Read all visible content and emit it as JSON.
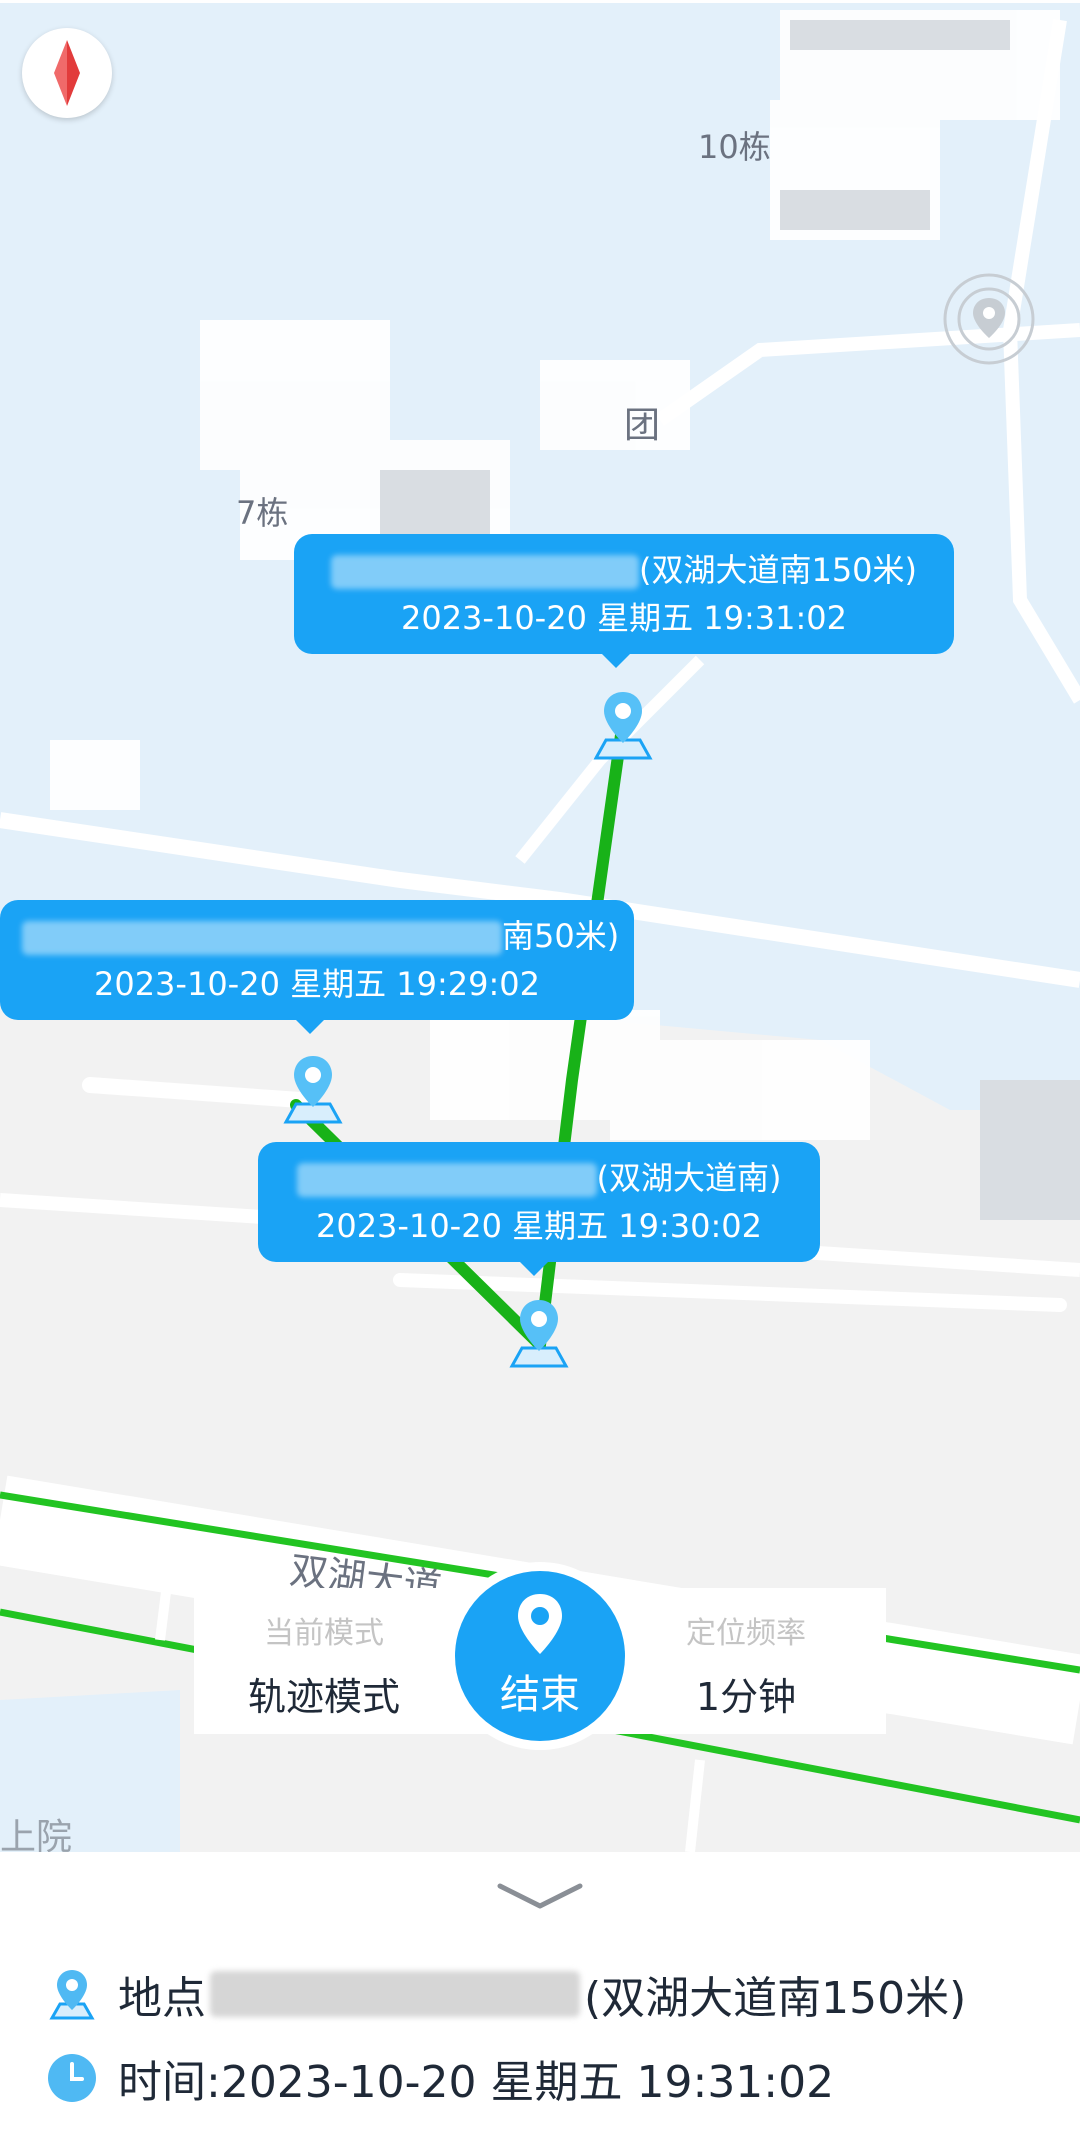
{
  "map": {
    "building_labels": [
      "10栋",
      "7栋",
      "团",
      "双湖大道",
      "上院"
    ],
    "bubbles": [
      {
        "text_visible": "(双湖大道南150米)",
        "time": "2023-10-20 星期五 19:31:02"
      },
      {
        "text_visible": "南50米)",
        "time": "2023-10-20 星期五 19:29:02"
      },
      {
        "text_visible": "(双湖大道南)",
        "time": "2023-10-20 星期五 19:30:02"
      }
    ]
  },
  "control": {
    "mode_label": "当前模式",
    "mode_value": "轨迹模式",
    "end_label": "结束",
    "freq_label": "定位频率",
    "freq_value": "1分钟"
  },
  "info": {
    "location_prefix": "地点",
    "location_suffix": "(双湖大道南150米)",
    "time_text": "时间:2023-10-20 星期五 19:31:02"
  },
  "colors": {
    "accent": "#1aa3f5",
    "track": "#18b218",
    "water": "#e3f0fa",
    "road_green": "#22c422"
  },
  "icons": [
    "compass-icon",
    "locate-icon",
    "location-pin-icon",
    "end-pin-icon",
    "chevron-down-icon",
    "clock-icon"
  ]
}
